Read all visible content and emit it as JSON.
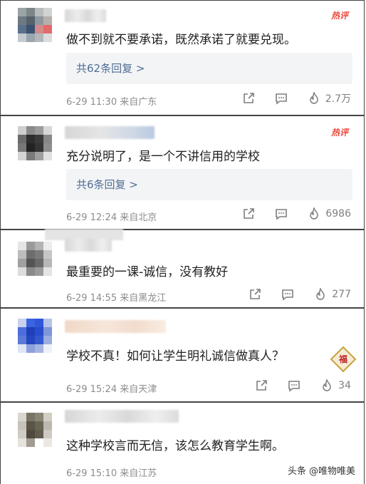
{
  "comments": [
    {
      "badge": "热评",
      "text": "做不到就不要承诺，既然承诺了就要兑现。",
      "replies": "共62条回复 >",
      "meta": "6-29 11:30 来自广东",
      "likes": "2.7万"
    },
    {
      "badge": "热评",
      "text": "充分说明了，是一个不讲信用的学校",
      "replies": "共6条回复 >",
      "meta": "6-29 12:24 来自北京",
      "likes": "6986"
    },
    {
      "text": "最重要的一课-诚信，没有教好",
      "meta": "6-29 14:55 来自黑龙江",
      "likes": "277"
    },
    {
      "text": "学校不真！如何让学生明礼诚信做真人？",
      "meta": "6-29 15:24 来自天津",
      "likes": "34",
      "emoji": "福"
    },
    {
      "text": "这种学校言而无信，该怎么教育学生啊。",
      "meta": "6-29 15:10 来自江苏"
    }
  ],
  "watermark": {
    "brand": "头条",
    "account": "@唯物唯美"
  },
  "colors": {
    "hot": "#e8483c",
    "link": "#4f6d94",
    "meta": "#8c8c8c"
  }
}
